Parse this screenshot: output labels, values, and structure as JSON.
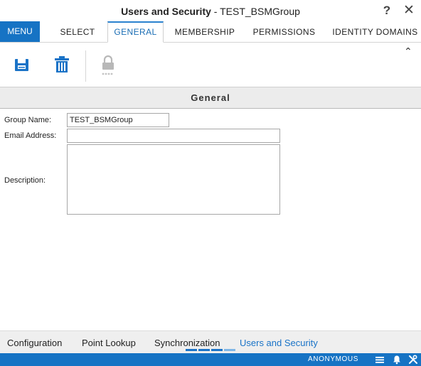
{
  "window": {
    "title_bold": "Users and Security",
    "title_rest": " - TEST_BSMGroup",
    "help_glyph": "?",
    "close_glyph": "✕"
  },
  "tabs": {
    "menu_label": "MENU",
    "items": [
      {
        "label": "SELECT",
        "active": false
      },
      {
        "label": "GENERAL",
        "active": true
      },
      {
        "label": "MEMBERSHIP",
        "active": false
      },
      {
        "label": "PERMISSIONS",
        "active": false
      },
      {
        "label": "IDENTITY DOMAINS",
        "active": false
      }
    ]
  },
  "toolbar": {
    "icons": [
      "save-icon",
      "delete-icon",
      "password-lock-icon"
    ],
    "collapse_glyph": "⌃"
  },
  "section": {
    "title": "General"
  },
  "form": {
    "group_name_label": "Group Name:",
    "group_name_value": "TEST_BSMGroup",
    "email_label": "Email Address:",
    "email_value": "",
    "description_label": "Description:",
    "description_value": ""
  },
  "bottom_tabs": [
    {
      "label": "Configuration",
      "active": false
    },
    {
      "label": "Point Lookup",
      "active": false
    },
    {
      "label": "Synchronization",
      "active": false
    },
    {
      "label": "Users and Security",
      "active": true
    }
  ],
  "status": {
    "user": "ANONYMOUS",
    "icons": [
      "menu-icon",
      "bell-icon",
      "tools-icon"
    ]
  },
  "colors": {
    "accent": "#1673c4",
    "active_tab_text": "#1a6db4",
    "disabled_icon": "#b8b8b8"
  }
}
